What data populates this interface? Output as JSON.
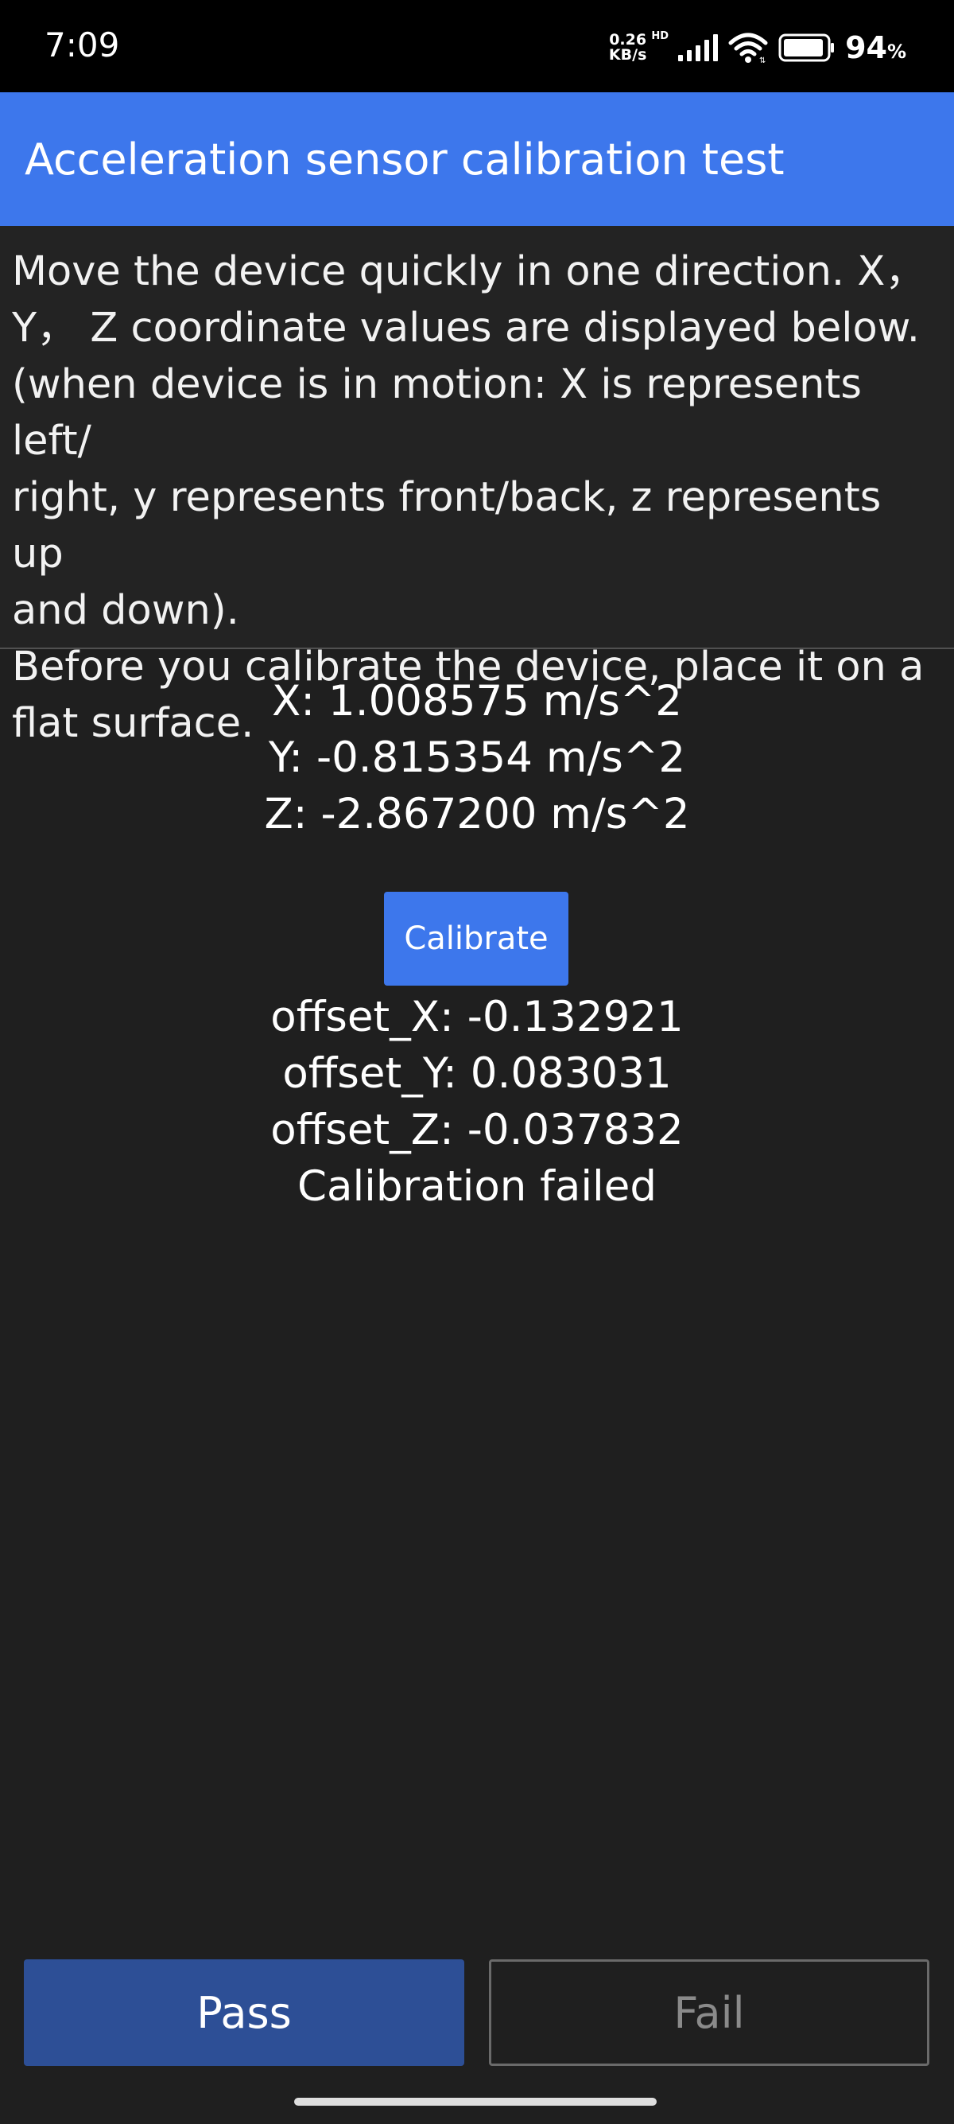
{
  "status_bar": {
    "time": "7:09",
    "net_speed_value": "0.26",
    "net_speed_unit": "KB/s",
    "hd_label": "HD",
    "battery_percent": "94",
    "battery_percent_symbol": "%",
    "battery_level": 0.94
  },
  "app_bar": {
    "title": "Acceleration sensor calibration test"
  },
  "instructions": {
    "text": "Move the device quickly in one direction. X，\nY， Z coordinate values are displayed below.\n(when device is in motion: X is represents left/\nright, y represents front/back, z represents up\nand down).\nBefore you calibrate the device, place it on a\nflat surface."
  },
  "readings": {
    "x": "X: 1.008575 m/s^2",
    "y": "Y: -0.815354 m/s^2",
    "z": "Z: -2.867200 m/s^2"
  },
  "calibrate_label": "Calibrate",
  "offsets": {
    "x": "offset_X: -0.132921",
    "y": "offset_Y: 0.083031",
    "z": "offset_Z: -0.037832",
    "status": "Calibration failed"
  },
  "buttons": {
    "pass": "Pass",
    "fail": "Fail"
  },
  "colors": {
    "accent": "#3d77ec",
    "pass_button": "#2d4f96",
    "background": "#1f1f1f",
    "status_bar": "#000000"
  },
  "icons": [
    "signal-icon",
    "wifi-icon",
    "battery-icon"
  ]
}
